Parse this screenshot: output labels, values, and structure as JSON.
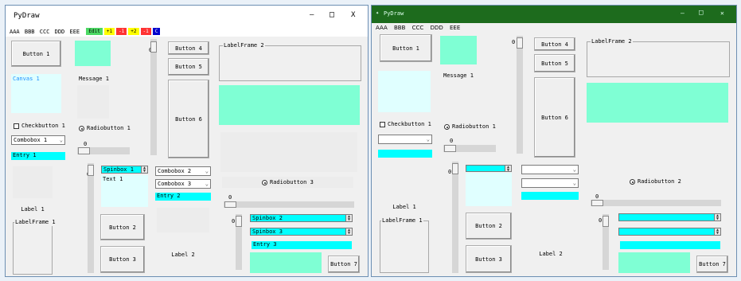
{
  "left": {
    "title": "PyDraw",
    "controls": {
      "minimize": "—",
      "maximize": "□",
      "close": "X"
    },
    "menu": [
      "AAA",
      "BBB",
      "CCC",
      "DDD",
      "EEE"
    ],
    "toolbar": [
      {
        "label": "Edit",
        "bg": "#4cd964",
        "fg": "#000000"
      },
      {
        "label": "+1",
        "bg": "#ffff00",
        "fg": "#000000"
      },
      {
        "label": "-1",
        "bg": "#ff3333",
        "fg": "#ffffff"
      },
      {
        "label": "+2",
        "bg": "#ffff00",
        "fg": "#000000"
      },
      {
        "label": "-1",
        "bg": "#ff3333",
        "fg": "#ffffff"
      },
      {
        "label": "C",
        "bg": "#0000cc",
        "fg": "#ffffff"
      }
    ],
    "button1": "Button 1",
    "canvas1": "Canvas 1",
    "message1": "Message 1",
    "checkbutton1": "Checkbutton 1",
    "radiobutton1": "Radiobutton 1",
    "combobox1": "Combobox 1",
    "combobox2": "Combobox 2",
    "combobox3": "Combobox 3",
    "entry1": "Entry 1",
    "entry2": "Entry 2",
    "entry3": "Entry 3",
    "spinbox1": "Spinbox 1",
    "spinbox2": "Spinbox 2",
    "spinbox3": "Spinbox 3",
    "text1": "Text 1",
    "label1": "Label 1",
    "label2": "Label 2",
    "labelframe1": "LabelFrame 1",
    "labelframe2": "LabelFrame 2",
    "button2": "Button 2",
    "button3": "Button 3",
    "button4": "Button 4",
    "button5": "Button 5",
    "button6": "Button 6",
    "button7": "Button 7",
    "radiobutton3": "Radiobutton 3",
    "scale_value": "0"
  },
  "right": {
    "title": "PyDraw",
    "controls": {
      "minimize": "—",
      "maximize": "□",
      "close": "✕"
    },
    "menu": [
      "AAA",
      "BBB",
      "CCC",
      "DDD",
      "EEE"
    ],
    "button1": "Button 1",
    "message1": "Message 1",
    "checkbutton1": "Checkbutton 1",
    "radiobutton1": "Radiobutton 1",
    "radiobutton2": "Radiobutton 2",
    "label1": "Label 1",
    "label2": "Label 2",
    "labelframe1": "LabelFrame 1",
    "labelframe2": "LabelFrame 2",
    "button2": "Button 2",
    "button3": "Button 3",
    "button4": "Button 4",
    "button5": "Button 5",
    "button6": "Button 6",
    "button7": "Button 7",
    "scale_value": "0"
  },
  "colors": {
    "aquamarine": "#7fffd4",
    "cyan": "#00ffff",
    "lightcyan": "#e0ffff",
    "titlebar_right": "#1d6b1d",
    "titlebar_left": "#ffffff"
  }
}
